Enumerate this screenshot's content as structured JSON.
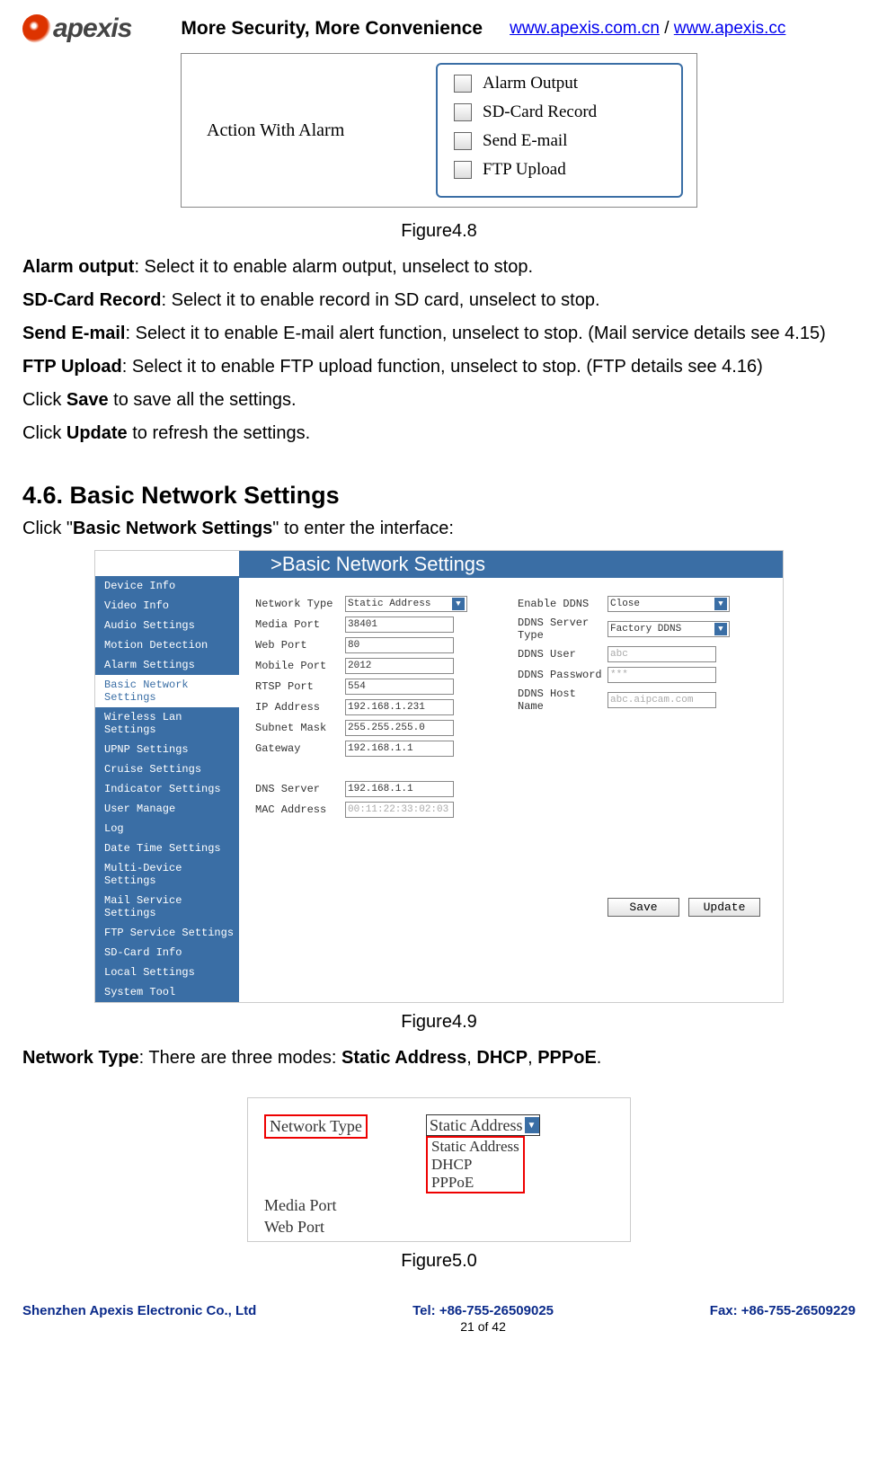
{
  "header": {
    "logo_text": "apexis",
    "slogan": "More Security, More Convenience",
    "link1": "www.apexis.com.cn",
    "sep": " / ",
    "link2": "www.apexis.cc"
  },
  "fig48": {
    "left_label": "Action With Alarm",
    "opts": [
      "Alarm Output",
      "SD-Card Record",
      "Send E-mail",
      "FTP Upload"
    ],
    "caption": "Figure4.8"
  },
  "descs": {
    "p1a": "Alarm output",
    "p1b": ": Select it to enable alarm output, unselect to stop.",
    "p2a": "SD-Card Record",
    "p2b": ": Select it to enable record in SD card, unselect to stop.",
    "p3a": "Send E-mail",
    "p3b": ": Select it to enable E-mail alert function, unselect to stop. (Mail service details see 4.15)",
    "p4a": "FTP Upload",
    "p4b": ": Select it to enable FTP upload function, unselect to stop. (FTP details see 4.16)",
    "p5a": "Click ",
    "p5b": "Save",
    "p5c": " to save all the settings.",
    "p6a": "Click ",
    "p6b": "Update",
    "p6c": " to refresh the settings."
  },
  "section": {
    "heading": "4.6. Basic Network Settings",
    "intro_a": "Click \"",
    "intro_b": "Basic Network Settings",
    "intro_c": "\" to enter the interface:"
  },
  "fig49": {
    "title": ">Basic Network Settings",
    "sidebar": [
      "Device Info",
      "Video Info",
      "Audio Settings",
      "Motion Detection",
      "Alarm Settings",
      "Basic Network Settings",
      "Wireless Lan Settings",
      "UPNP Settings",
      "Cruise Settings",
      "Indicator Settings",
      "User Manage",
      "Log",
      "Date Time Settings",
      "Multi-Device Settings",
      "Mail Service Settings",
      "FTP Service Settings",
      "SD-Card Info",
      "Local Settings",
      "System Tool"
    ],
    "selected_index": 5,
    "left": [
      {
        "l": "Network Type",
        "v": "Static Address",
        "type": "sel"
      },
      {
        "l": "Media Port",
        "v": "38401"
      },
      {
        "l": "Web Port",
        "v": "80"
      },
      {
        "l": "Mobile Port",
        "v": "2012"
      },
      {
        "l": "RTSP Port",
        "v": "554"
      },
      {
        "l": "IP Address",
        "v": "192.168.1.231"
      },
      {
        "l": "Subnet Mask",
        "v": "255.255.255.0"
      },
      {
        "l": "Gateway",
        "v": "192.168.1.1"
      }
    ],
    "left2": [
      {
        "l": "DNS Server",
        "v": "192.168.1.1"
      },
      {
        "l": "MAC Address",
        "v": "00:11:22:33:02:03",
        "dis": true
      }
    ],
    "right": [
      {
        "l": "Enable DDNS",
        "v": "Close",
        "type": "sel"
      },
      {
        "l": "DDNS Server Type",
        "v": "Factory DDNS",
        "type": "sel"
      },
      {
        "l": "DDNS User",
        "v": "abc",
        "dis": true
      },
      {
        "l": "DDNS Password",
        "v": "***",
        "dis": true
      },
      {
        "l": "DDNS Host Name",
        "v": "abc.aipcam.com",
        "dis": true
      }
    ],
    "btn_save": "Save",
    "btn_update": "Update",
    "caption": "Figure4.9"
  },
  "net_type_line": {
    "a": "Network Type",
    "b": ": There are three modes: ",
    "c": "Static Address",
    "d": ", ",
    "e": "DHCP",
    "f": ", ",
    "g": "PPPoE",
    "h": "."
  },
  "fig50": {
    "r1l": "Network Type",
    "r1v": "Static Address",
    "r2l": "Media Port",
    "r3l": "Web Port",
    "drop": [
      "Static Address",
      "DHCP",
      "PPPoE"
    ],
    "caption": "Figure5.0"
  },
  "footer": {
    "left": "Shenzhen Apexis Electronic Co., Ltd",
    "center": "Tel: +86-755-26509025",
    "page": "21 of 42",
    "right": "Fax: +86-755-26509229"
  }
}
